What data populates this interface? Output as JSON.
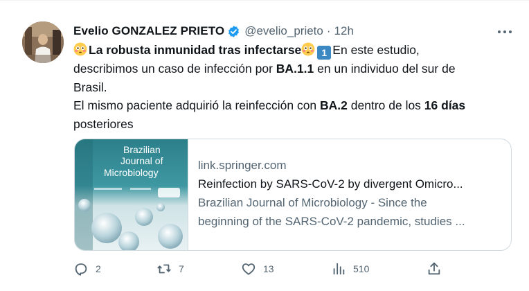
{
  "author": {
    "name": "Evelio GONZALEZ PRIETO",
    "handle": "@evelio_prieto",
    "separator": "·",
    "time": "12h"
  },
  "body": {
    "emoji": "flushed-face-emoji",
    "headline": "La robusta inmunidad tras infectarse",
    "keycap": "1",
    "line1_rest": "En este estudio,",
    "line2_pre": "describimos un caso de infección por ",
    "line2_bold": "BA.1.1",
    "line2_post": " en un individuo del sur de",
    "line3": "Brasil.",
    "line4_pre": "El mismo paciente adquirió la reinfección con ",
    "line4_bold1": "BA.2",
    "line4_mid": " dentro de los ",
    "line4_bold2": "16 días",
    "line5": "posteriores"
  },
  "card": {
    "image_title_lines": [
      "Brazilian",
      "Journal of",
      "Microbiology"
    ],
    "domain": "link.springer.com",
    "title": "Reinfection by SARS-CoV-2 by divergent Omicro...",
    "desc_line1": "Brazilian Journal of Microbiology - Since the",
    "desc_line2": "beginning of the SARS-CoV-2 pandemic, studies ..."
  },
  "actions": {
    "replies": "2",
    "reposts": "7",
    "likes": "13",
    "views": "510"
  },
  "colors": {
    "text": "#0f1419",
    "secondary": "#536471",
    "verified": "#1d9bf0",
    "border": "#cfd9de",
    "keycap": "#3b88c3"
  },
  "icons": [
    "verified-badge-icon",
    "more-icon",
    "reply-icon",
    "repost-icon",
    "like-icon",
    "views-icon",
    "share-icon"
  ]
}
